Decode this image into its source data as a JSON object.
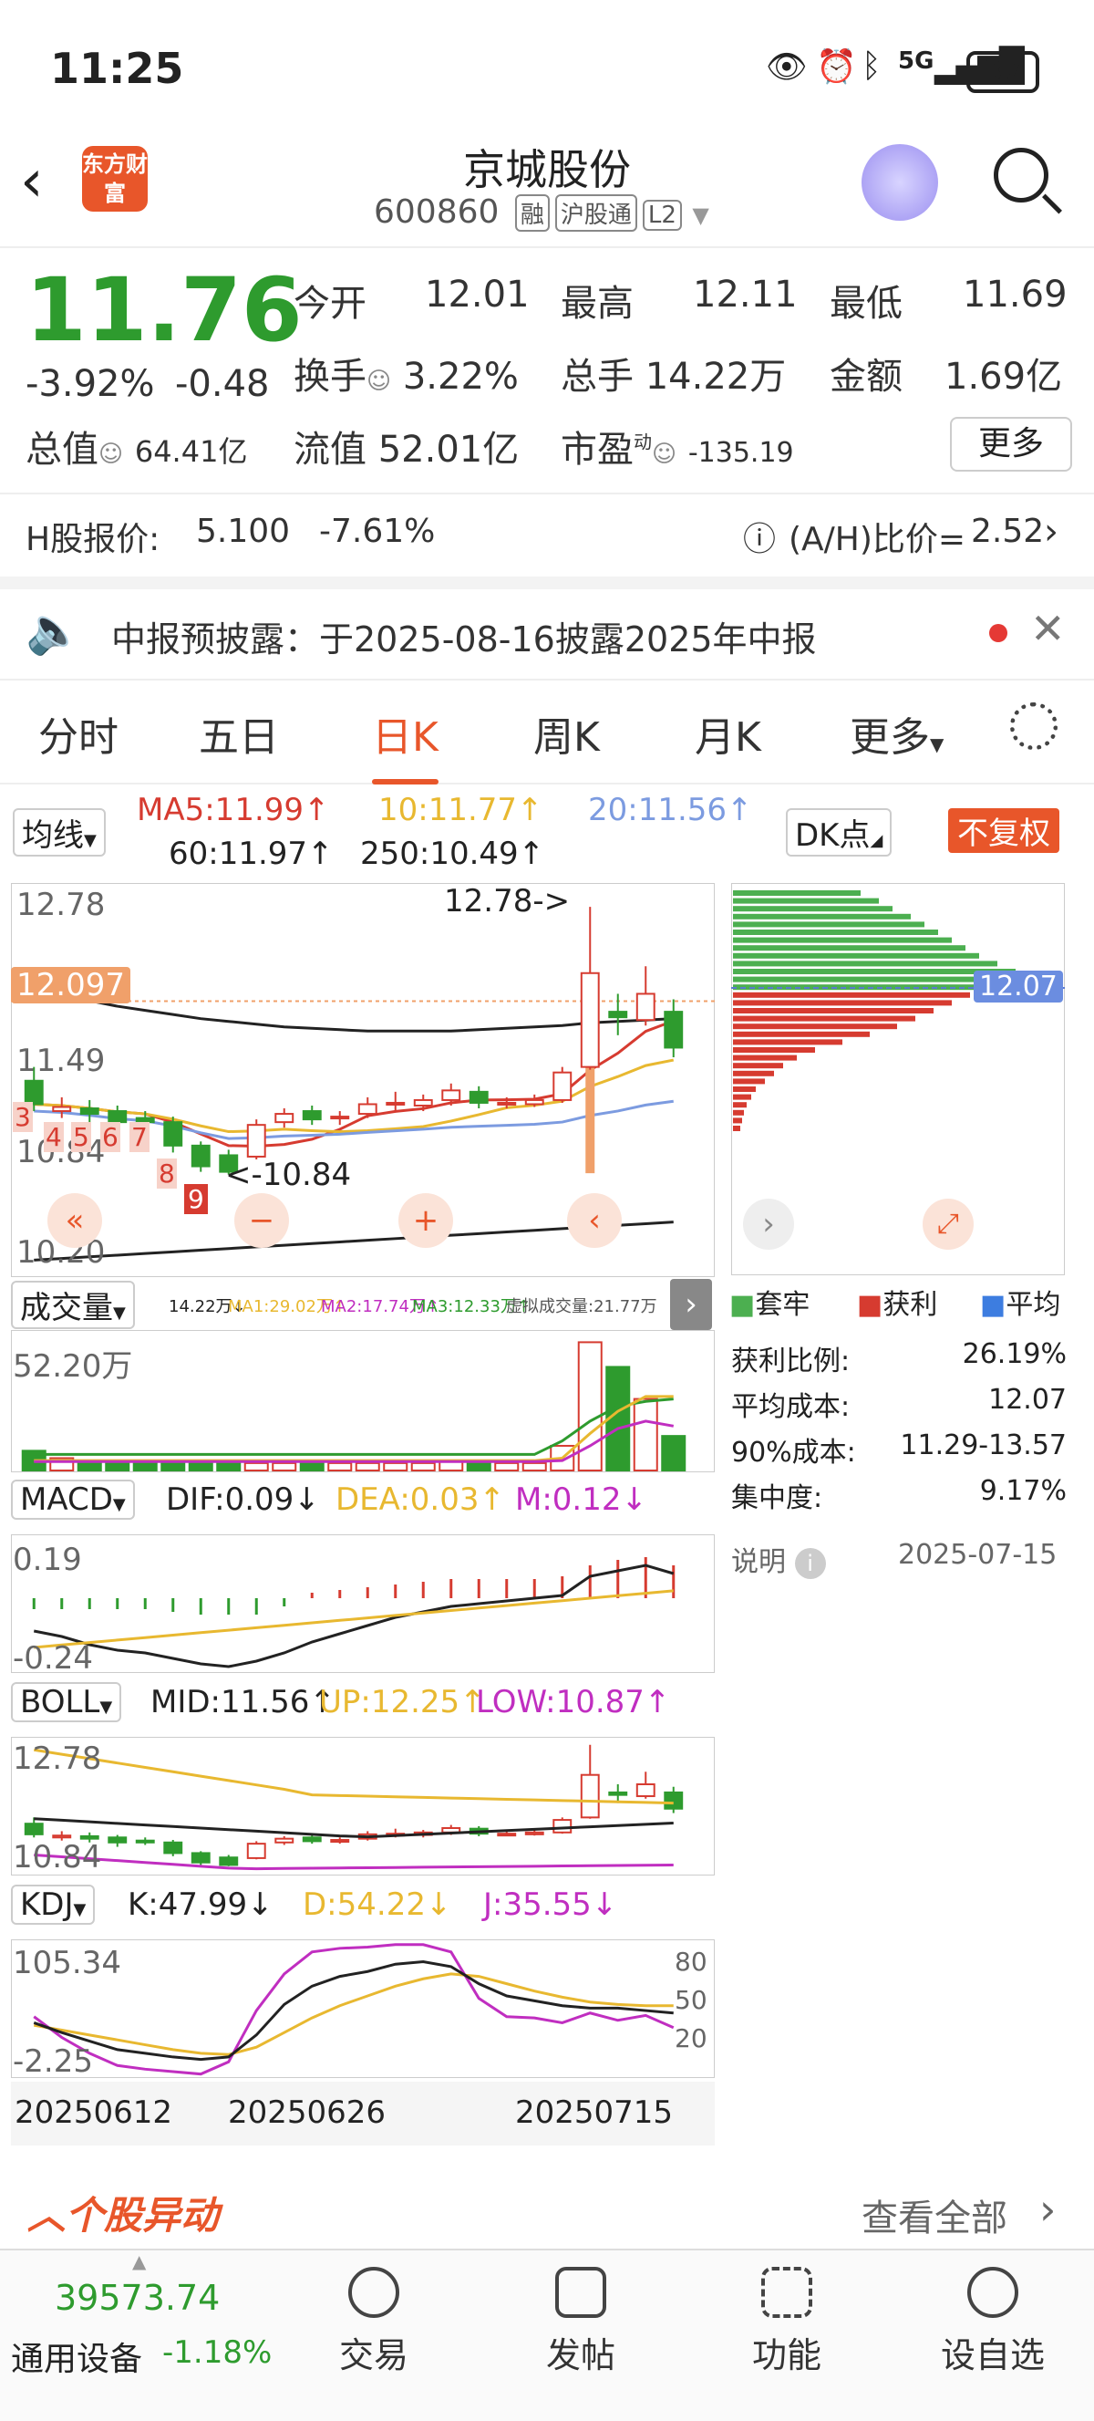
{
  "status": {
    "time": "11:25",
    "battery": "37",
    "network": "5G"
  },
  "header": {
    "title": "京城股份",
    "code": "600860",
    "tags": [
      "融",
      "沪股通",
      "L2"
    ],
    "logo_text": "东方财富"
  },
  "quote": {
    "price": "11.76",
    "change_pct": "-3.92%",
    "change": "-0.48",
    "open_label": "今开",
    "open": "12.01",
    "high_label": "最高",
    "high": "12.11",
    "low_label": "最低",
    "low": "11.69",
    "turnover_label": "换手",
    "turnover": "3.22%",
    "volume_label": "总手",
    "volume": "14.22万",
    "amount_label": "金额",
    "amount": "1.69亿",
    "mktcap_label": "总值",
    "mktcap": "64.41亿",
    "float_label": "流值",
    "float": "52.01亿",
    "pe_label": "市盈",
    "pe_sup": "动",
    "pe": "-135.19",
    "more_label": "更多"
  },
  "hshare": {
    "label": "H股报价:",
    "price": "5.100",
    "change": "-7.61%",
    "ratio_label": "(A/H)比价=",
    "ratio": "2.52"
  },
  "notice": {
    "text": "中报预披露：于2025-08-16披露2025年中报"
  },
  "tabs": [
    "分时",
    "五日",
    "日K",
    "周K",
    "月K",
    "更多"
  ],
  "active_tab": "日K",
  "colors": {
    "up": "#d63b30",
    "down": "#2e9b2e",
    "accent": "#e8562a",
    "ma5": "#d63b30",
    "ma10": "#e8b830",
    "ma20": "#7c9be0",
    "ma60": "#222222",
    "ma250": "#222222"
  },
  "ma_bar": {
    "select": "均线",
    "ma5": "MA5:11.99↑",
    "ma10": "10:11.77↑",
    "ma20": "20:11.56↑",
    "ma60": "60:11.97↑",
    "ma250": "250:10.49↑",
    "dk": "DK点",
    "fq": "不复权"
  },
  "kline": {
    "ymax": "12.78",
    "ymid": "12.097",
    "y3": "11.49",
    "y4": "10.84",
    "ymin": "10.20",
    "high_note": "12.78->",
    "low_note": "<-10.84",
    "countdown": [
      "3",
      "4",
      "5",
      "6",
      "7",
      "8",
      "9"
    ]
  },
  "chip": {
    "price": "12.07",
    "legend": [
      "套牢",
      "获利",
      "平均"
    ],
    "rows": [
      {
        "label": "获利比例:",
        "value": "26.19%"
      },
      {
        "label": "平均成本:",
        "value": "12.07"
      },
      {
        "label": "90%成本:",
        "value": "11.29-13.57"
      },
      {
        "label": "集中度:",
        "value": "9.17%"
      }
    ],
    "note_label": "说明",
    "date": "2025-07-15"
  },
  "volume": {
    "select": "成交量",
    "vol": "14.22万↓",
    "ma1": "MA1:29.02万↑",
    "ma2": "MA2:17.74万↑",
    "ma3": "MA3:12.33万↑",
    "virtual": "虚拟成交量:21.77万",
    "ymax": "52.20万"
  },
  "macd": {
    "select": "MACD",
    "dif": "DIF:0.09↓",
    "dea": "DEA:0.03↑",
    "m": "M:0.12↓",
    "ymax": "0.19",
    "ymin": "-0.24"
  },
  "boll": {
    "select": "BOLL",
    "mid": "MID:11.56↑",
    "up": "UP:12.25↑",
    "low": "LOW:10.87↑",
    "ymax": "12.78",
    "ymin": "10.84"
  },
  "kdj": {
    "select": "KDJ",
    "k": "K:47.99↓",
    "d": "D:54.22↓",
    "j": "J:35.55↓",
    "ymax": "105.34",
    "ymin": "-2.25",
    "r80": "80",
    "r50": "50",
    "r20": "20"
  },
  "xaxis": [
    "20250612",
    "20250626",
    "20250715"
  ],
  "movers": {
    "title": "个股异动",
    "view_all": "查看全部"
  },
  "bottom_nav": {
    "index_value": "39573.74",
    "index_name": "通用设备",
    "index_change": "-1.18%",
    "items": [
      "交易",
      "发帖",
      "功能",
      "设自选"
    ]
  },
  "candles": [
    {
      "o": 11.52,
      "c": 11.35,
      "h": 11.62,
      "l": 11.3
    },
    {
      "o": 11.3,
      "c": 11.33,
      "h": 11.4,
      "l": 11.25
    },
    {
      "o": 11.32,
      "c": 11.28,
      "h": 11.38,
      "l": 11.22
    },
    {
      "o": 11.3,
      "c": 11.22,
      "h": 11.34,
      "l": 11.15
    },
    {
      "o": 11.25,
      "c": 11.22,
      "h": 11.3,
      "l": 11.18
    },
    {
      "o": 11.22,
      "c": 11.05,
      "h": 11.26,
      "l": 11.0
    },
    {
      "o": 11.05,
      "c": 10.9,
      "h": 11.08,
      "l": 10.86
    },
    {
      "o": 10.98,
      "c": 10.86,
      "h": 11.02,
      "l": 10.84
    },
    {
      "o": 10.97,
      "c": 11.2,
      "h": 11.24,
      "l": 10.95
    },
    {
      "o": 11.22,
      "c": 11.28,
      "h": 11.32,
      "l": 11.18
    },
    {
      "o": 11.3,
      "c": 11.24,
      "h": 11.34,
      "l": 11.2
    },
    {
      "o": 11.26,
      "c": 11.26,
      "h": 11.3,
      "l": 11.2
    },
    {
      "o": 11.28,
      "c": 11.35,
      "h": 11.4,
      "l": 11.25
    },
    {
      "o": 11.36,
      "c": 11.36,
      "h": 11.44,
      "l": 11.3
    },
    {
      "o": 11.34,
      "c": 11.38,
      "h": 11.42,
      "l": 11.3
    },
    {
      "o": 11.38,
      "c": 11.45,
      "h": 11.5,
      "l": 11.34
    },
    {
      "o": 11.44,
      "c": 11.36,
      "h": 11.48,
      "l": 11.32
    },
    {
      "o": 11.36,
      "c": 11.36,
      "h": 11.4,
      "l": 11.32
    },
    {
      "o": 11.35,
      "c": 11.38,
      "h": 11.42,
      "l": 11.33
    },
    {
      "o": 11.38,
      "c": 11.58,
      "h": 11.62,
      "l": 11.36
    },
    {
      "o": 11.62,
      "c": 12.3,
      "h": 12.78,
      "l": 11.6
    },
    {
      "o": 12.02,
      "c": 11.98,
      "h": 12.15,
      "l": 11.85
    },
    {
      "o": 11.96,
      "c": 12.15,
      "h": 12.35,
      "l": 11.92
    },
    {
      "o": 12.02,
      "c": 11.76,
      "h": 12.11,
      "l": 11.69
    }
  ],
  "volumes": [
    8,
    5,
    4,
    4,
    4,
    4,
    3,
    3,
    3,
    3,
    3,
    3,
    3,
    3,
    3,
    4,
    3,
    3,
    3,
    10,
    52,
    42,
    29,
    14
  ]
}
